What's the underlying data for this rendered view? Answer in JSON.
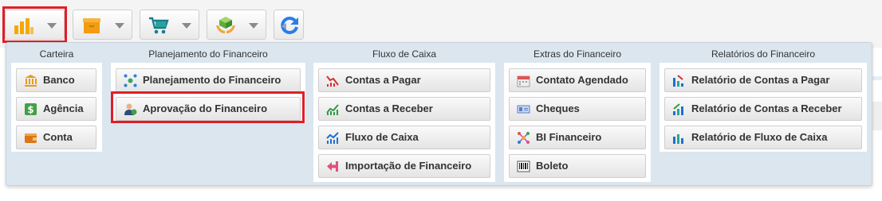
{
  "toolbar": {
    "buttons": [
      {
        "name": "financeiro-chart-icon",
        "highlighted": true
      },
      {
        "name": "box-icon"
      },
      {
        "name": "cart-icon"
      },
      {
        "name": "hands-cube-icon"
      }
    ],
    "refresh_icon": "refresh-icon"
  },
  "menu": {
    "columns": [
      {
        "title": "Carteira",
        "items": [
          {
            "label": "Banco",
            "icon": "bank-icon"
          },
          {
            "label": "Agência",
            "icon": "dollar-icon"
          },
          {
            "label": "Conta",
            "icon": "wallet-icon"
          }
        ]
      },
      {
        "title": "Planejamento do Financeiro",
        "items": [
          {
            "label": "Planejamento do Financeiro",
            "icon": "network-icon"
          },
          {
            "label": "Aprovação do Financeiro",
            "icon": "user-approve-icon",
            "highlighted": true
          }
        ]
      },
      {
        "title": "Fluxo de Caixa",
        "items": [
          {
            "label": "Contas a Pagar",
            "icon": "chart-down-icon"
          },
          {
            "label": "Contas a Receber",
            "icon": "chart-up-icon"
          },
          {
            "label": "Fluxo de Caixa",
            "icon": "chart-flow-icon"
          },
          {
            "label": "Importação de Financeiro",
            "icon": "import-icon"
          }
        ]
      },
      {
        "title": "Extras do Financeiro",
        "items": [
          {
            "label": "Contato Agendado",
            "icon": "calendar-icon"
          },
          {
            "label": "Cheques",
            "icon": "cheque-icon"
          },
          {
            "label": "BI Financeiro",
            "icon": "bi-icon"
          },
          {
            "label": "Boleto",
            "icon": "barcode-icon"
          }
        ]
      },
      {
        "title": "Relatórios do Financeiro",
        "items": [
          {
            "label": "Relatório de Contas a Pagar",
            "icon": "report-pay-icon"
          },
          {
            "label": "Relatório de Contas a Receber",
            "icon": "report-receive-icon"
          },
          {
            "label": "Relatório de Fluxo de Caixa",
            "icon": "report-flow-icon"
          }
        ]
      }
    ]
  },
  "colors": {
    "accent_red": "#e01e26",
    "menu_bg": "#dbe6ef"
  }
}
